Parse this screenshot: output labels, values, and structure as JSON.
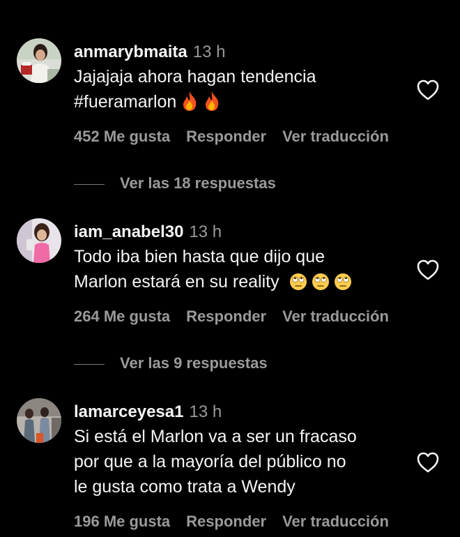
{
  "comments": [
    {
      "username": "anmarybmaita",
      "time": "13 h",
      "text_line1": "Jajajaja ahora hagan tendencia",
      "text_line2": "#fueramarlon",
      "emojis": [
        "fire",
        "fire"
      ],
      "likes": "452 Me gusta",
      "reply": "Responder",
      "translate": "Ver traducción",
      "view_replies": "Ver las 18 respuestas"
    },
    {
      "username": "iam_anabel30",
      "time": "13 h",
      "text_line1": "Todo iba bien hasta que dijo que",
      "text_line2": "Marlon estará en su reality",
      "emojis": [
        "rolling-eyes",
        "rolling-eyes",
        "rolling-eyes"
      ],
      "likes": "264 Me gusta",
      "reply": "Responder",
      "translate": "Ver traducción",
      "view_replies": "Ver las 9 respuestas"
    },
    {
      "username": "lamarceyesa1",
      "time": "13 h",
      "text_line1": "Si está el Marlon va a ser un fracaso",
      "text_line2": "por que a la mayoría del público no",
      "text_line3": "le gusta como trata a Wendy",
      "likes": "196 Me gusta",
      "reply": "Responder",
      "translate": "Ver traducción"
    }
  ],
  "icons": {
    "like": "heart-outline-icon"
  },
  "colors": {
    "background": "#000000",
    "primary_text": "#f5f5f5",
    "secondary_text": "#9a9a9a"
  }
}
